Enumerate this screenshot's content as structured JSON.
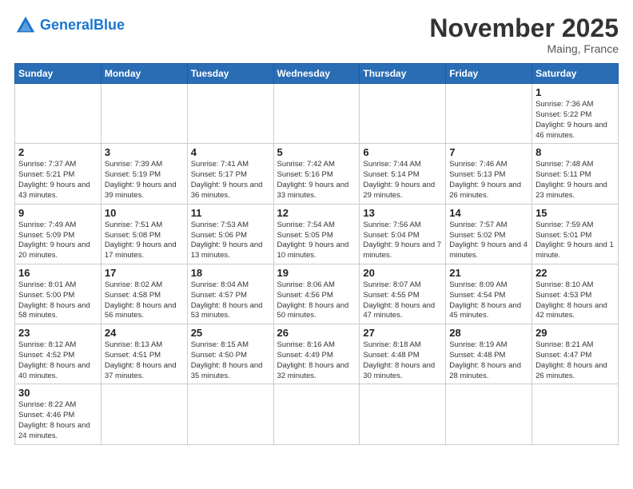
{
  "logo": {
    "general": "General",
    "blue": "Blue"
  },
  "header": {
    "month": "November 2025",
    "location": "Maing, France"
  },
  "weekdays": [
    "Sunday",
    "Monday",
    "Tuesday",
    "Wednesday",
    "Thursday",
    "Friday",
    "Saturday"
  ],
  "weeks": [
    [
      {
        "day": "",
        "info": ""
      },
      {
        "day": "",
        "info": ""
      },
      {
        "day": "",
        "info": ""
      },
      {
        "day": "",
        "info": ""
      },
      {
        "day": "",
        "info": ""
      },
      {
        "day": "",
        "info": ""
      },
      {
        "day": "1",
        "info": "Sunrise: 7:36 AM\nSunset: 5:22 PM\nDaylight: 9 hours and 46 minutes."
      }
    ],
    [
      {
        "day": "2",
        "info": "Sunrise: 7:37 AM\nSunset: 5:21 PM\nDaylight: 9 hours and 43 minutes."
      },
      {
        "day": "3",
        "info": "Sunrise: 7:39 AM\nSunset: 5:19 PM\nDaylight: 9 hours and 39 minutes."
      },
      {
        "day": "4",
        "info": "Sunrise: 7:41 AM\nSunset: 5:17 PM\nDaylight: 9 hours and 36 minutes."
      },
      {
        "day": "5",
        "info": "Sunrise: 7:42 AM\nSunset: 5:16 PM\nDaylight: 9 hours and 33 minutes."
      },
      {
        "day": "6",
        "info": "Sunrise: 7:44 AM\nSunset: 5:14 PM\nDaylight: 9 hours and 29 minutes."
      },
      {
        "day": "7",
        "info": "Sunrise: 7:46 AM\nSunset: 5:13 PM\nDaylight: 9 hours and 26 minutes."
      },
      {
        "day": "8",
        "info": "Sunrise: 7:48 AM\nSunset: 5:11 PM\nDaylight: 9 hours and 23 minutes."
      }
    ],
    [
      {
        "day": "9",
        "info": "Sunrise: 7:49 AM\nSunset: 5:09 PM\nDaylight: 9 hours and 20 minutes."
      },
      {
        "day": "10",
        "info": "Sunrise: 7:51 AM\nSunset: 5:08 PM\nDaylight: 9 hours and 17 minutes."
      },
      {
        "day": "11",
        "info": "Sunrise: 7:53 AM\nSunset: 5:06 PM\nDaylight: 9 hours and 13 minutes."
      },
      {
        "day": "12",
        "info": "Sunrise: 7:54 AM\nSunset: 5:05 PM\nDaylight: 9 hours and 10 minutes."
      },
      {
        "day": "13",
        "info": "Sunrise: 7:56 AM\nSunset: 5:04 PM\nDaylight: 9 hours and 7 minutes."
      },
      {
        "day": "14",
        "info": "Sunrise: 7:57 AM\nSunset: 5:02 PM\nDaylight: 9 hours and 4 minutes."
      },
      {
        "day": "15",
        "info": "Sunrise: 7:59 AM\nSunset: 5:01 PM\nDaylight: 9 hours and 1 minute."
      }
    ],
    [
      {
        "day": "16",
        "info": "Sunrise: 8:01 AM\nSunset: 5:00 PM\nDaylight: 8 hours and 58 minutes."
      },
      {
        "day": "17",
        "info": "Sunrise: 8:02 AM\nSunset: 4:58 PM\nDaylight: 8 hours and 56 minutes."
      },
      {
        "day": "18",
        "info": "Sunrise: 8:04 AM\nSunset: 4:57 PM\nDaylight: 8 hours and 53 minutes."
      },
      {
        "day": "19",
        "info": "Sunrise: 8:06 AM\nSunset: 4:56 PM\nDaylight: 8 hours and 50 minutes."
      },
      {
        "day": "20",
        "info": "Sunrise: 8:07 AM\nSunset: 4:55 PM\nDaylight: 8 hours and 47 minutes."
      },
      {
        "day": "21",
        "info": "Sunrise: 8:09 AM\nSunset: 4:54 PM\nDaylight: 8 hours and 45 minutes."
      },
      {
        "day": "22",
        "info": "Sunrise: 8:10 AM\nSunset: 4:53 PM\nDaylight: 8 hours and 42 minutes."
      }
    ],
    [
      {
        "day": "23",
        "info": "Sunrise: 8:12 AM\nSunset: 4:52 PM\nDaylight: 8 hours and 40 minutes."
      },
      {
        "day": "24",
        "info": "Sunrise: 8:13 AM\nSunset: 4:51 PM\nDaylight: 8 hours and 37 minutes."
      },
      {
        "day": "25",
        "info": "Sunrise: 8:15 AM\nSunset: 4:50 PM\nDaylight: 8 hours and 35 minutes."
      },
      {
        "day": "26",
        "info": "Sunrise: 8:16 AM\nSunset: 4:49 PM\nDaylight: 8 hours and 32 minutes."
      },
      {
        "day": "27",
        "info": "Sunrise: 8:18 AM\nSunset: 4:48 PM\nDaylight: 8 hours and 30 minutes."
      },
      {
        "day": "28",
        "info": "Sunrise: 8:19 AM\nSunset: 4:48 PM\nDaylight: 8 hours and 28 minutes."
      },
      {
        "day": "29",
        "info": "Sunrise: 8:21 AM\nSunset: 4:47 PM\nDaylight: 8 hours and 26 minutes."
      }
    ],
    [
      {
        "day": "30",
        "info": "Sunrise: 8:22 AM\nSunset: 4:46 PM\nDaylight: 8 hours and 24 minutes."
      },
      {
        "day": "",
        "info": ""
      },
      {
        "day": "",
        "info": ""
      },
      {
        "day": "",
        "info": ""
      },
      {
        "day": "",
        "info": ""
      },
      {
        "day": "",
        "info": ""
      },
      {
        "day": "",
        "info": ""
      }
    ]
  ]
}
